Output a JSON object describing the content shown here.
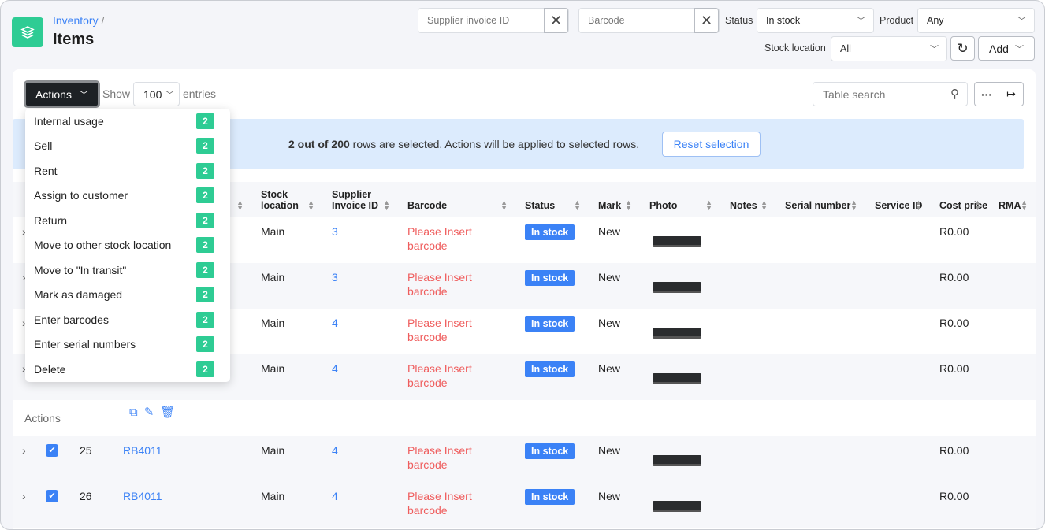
{
  "header": {
    "breadcrumb": "Inventory",
    "separator": "/",
    "title": "Items"
  },
  "filters": {
    "supplier_invoice_placeholder": "Supplier invoice ID",
    "barcode_placeholder": "Barcode",
    "status_label": "Status",
    "status_value": "In stock",
    "product_label": "Product",
    "product_value": "Any",
    "stock_location_label": "Stock location",
    "stock_location_value": "All",
    "add_label": "Add"
  },
  "toolbar": {
    "actions_label": "Actions",
    "show_label": "Show",
    "entries_value": "100",
    "entries_label": "entries",
    "search_placeholder": "Table search"
  },
  "selection": {
    "count_text": "2 out of 200",
    "message": " rows are selected. Actions will be applied to selected rows.",
    "reset_label": "Reset selection"
  },
  "actions_menu": [
    {
      "label": "Internal usage",
      "count": "2"
    },
    {
      "label": "Sell",
      "count": "2"
    },
    {
      "label": "Rent",
      "count": "2"
    },
    {
      "label": "Assign to customer",
      "count": "2"
    },
    {
      "label": "Return",
      "count": "2"
    },
    {
      "label": "Move to other stock location",
      "count": "2"
    },
    {
      "label": "Move to \"In transit\"",
      "count": "2"
    },
    {
      "label": "Mark as damaged",
      "count": "2"
    },
    {
      "label": "Enter barcodes",
      "count": "2"
    },
    {
      "label": "Enter serial numbers",
      "count": "2"
    },
    {
      "label": "Delete",
      "count": "2"
    }
  ],
  "table": {
    "columns": [
      "",
      "",
      "",
      "r",
      "Stock location",
      "Supplier Invoice ID",
      "Barcode",
      "Status",
      "Mark",
      "Photo",
      "Notes",
      "Serial number",
      "Service ID",
      "Cost price",
      "RMA"
    ],
    "rows": [
      {
        "id": "",
        "product": "",
        "location": "Main",
        "invoice": "3",
        "barcode": "Please Insert barcode",
        "status": "In stock",
        "mark": "New",
        "cost": "R0.00",
        "checked": false
      },
      {
        "id": "",
        "product": "",
        "location": "Main",
        "invoice": "3",
        "barcode": "Please Insert barcode",
        "status": "In stock",
        "mark": "New",
        "cost": "R0.00",
        "checked": false
      },
      {
        "id": "",
        "product": "",
        "location": "Main",
        "invoice": "4",
        "barcode": "Please Insert barcode",
        "status": "In stock",
        "mark": "New",
        "cost": "R0.00",
        "checked": false
      },
      {
        "id": "",
        "product": "",
        "location": "Main",
        "invoice": "4",
        "barcode": "Please Insert barcode",
        "status": "In stock",
        "mark": "New",
        "cost": "R0.00",
        "checked": false
      },
      {
        "id": "25",
        "product": "RB4011",
        "location": "Main",
        "invoice": "4",
        "barcode": "Please Insert barcode",
        "status": "In stock",
        "mark": "New",
        "cost": "R0.00",
        "checked": true
      },
      {
        "id": "26",
        "product": "RB4011",
        "location": "Main",
        "invoice": "4",
        "barcode": "Please Insert barcode",
        "status": "In stock",
        "mark": "New",
        "cost": "R0.00",
        "checked": true
      }
    ],
    "details_actions_label": "Actions"
  },
  "colors": {
    "accent": "#3b82f6",
    "brand": "#2ecc94",
    "danger": "#ef5d5d",
    "banner": "#dcebfd"
  }
}
